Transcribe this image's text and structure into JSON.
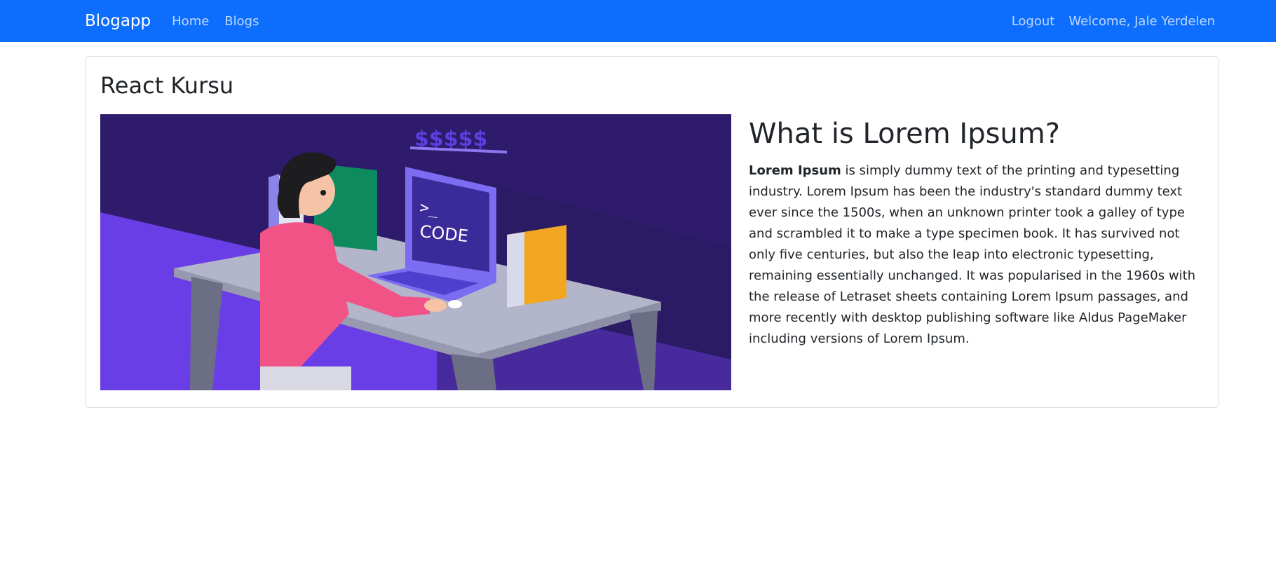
{
  "navbar": {
    "brand": "Blogapp",
    "links": [
      {
        "label": "Home"
      },
      {
        "label": "Blogs"
      }
    ],
    "right": [
      {
        "label": "Logout"
      },
      {
        "label": "Welcome, Jale Yerdelen"
      }
    ],
    "background_color": "#0d6efd"
  },
  "post": {
    "title": "React Kursu",
    "image": {
      "screen_text": ">_\nCODE",
      "money_text": "$$$$$"
    },
    "article": {
      "heading": "What is Lorem Ipsum?",
      "bold_lead": "Lorem Ipsum",
      "body": " is simply dummy text of the printing and typesetting industry. Lorem Ipsum has been the industry's standard dummy text ever since the 1500s, when an unknown printer took a galley of type and scrambled it to make a type specimen book. It has survived not only five centuries, but also the leap into electronic typesetting, remaining essentially unchanged. It was popularised in the 1960s with the release of Letraset sheets containing Lorem Ipsum passages, and more recently with desktop publishing software like Aldus PageMaker including versions of Lorem Ipsum."
    }
  }
}
